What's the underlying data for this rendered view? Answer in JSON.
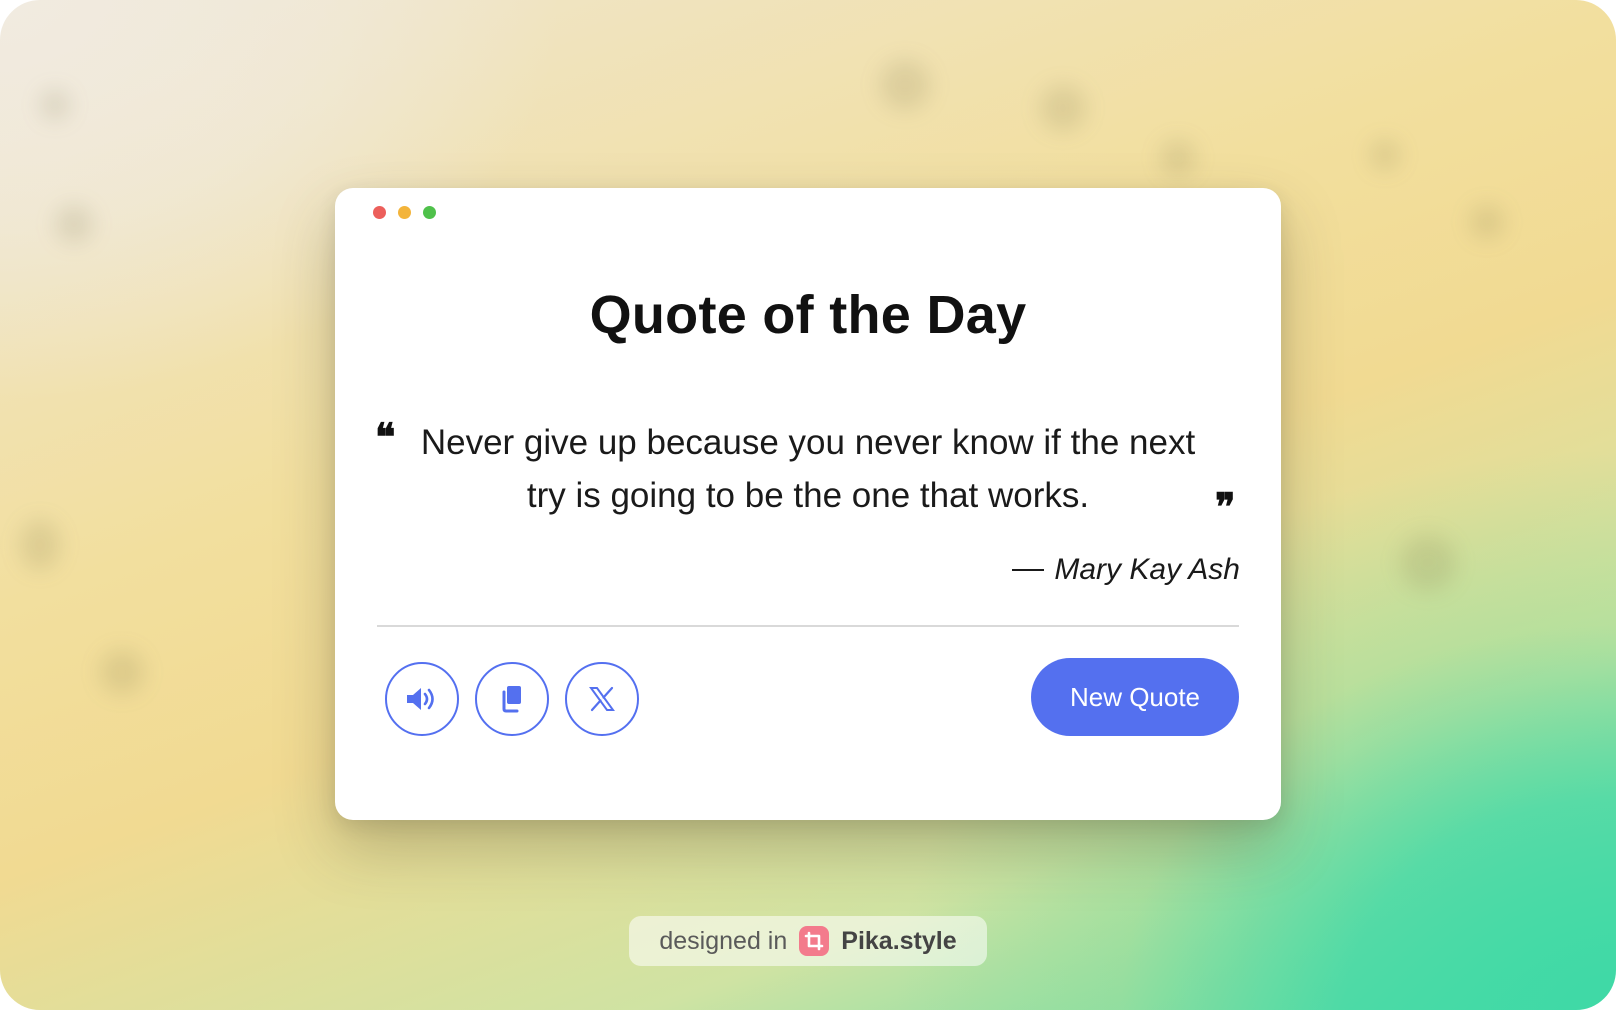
{
  "window": {
    "controls": [
      {
        "name": "close",
        "color": "#ec5f5b"
      },
      {
        "name": "minimize",
        "color": "#f3b43b"
      },
      {
        "name": "maximize",
        "color": "#4fc14b"
      }
    ]
  },
  "card": {
    "title": "Quote of the Day",
    "open_quote": "❝",
    "close_quote": "❞",
    "quote": "Never give up because you never know if the next try is going to be the one that works.",
    "author": "Mary Kay Ash",
    "actions": [
      {
        "id": "speak",
        "icon": "speaker-icon"
      },
      {
        "id": "copy",
        "icon": "copy-icon"
      },
      {
        "id": "share-x",
        "icon": "x-logo-icon"
      }
    ],
    "new_quote_label": "New Quote",
    "accent_color": "#5470ef"
  },
  "footer": {
    "prefix": "designed in",
    "brand": "Pika.style",
    "logo_color": "#f37b8c"
  }
}
